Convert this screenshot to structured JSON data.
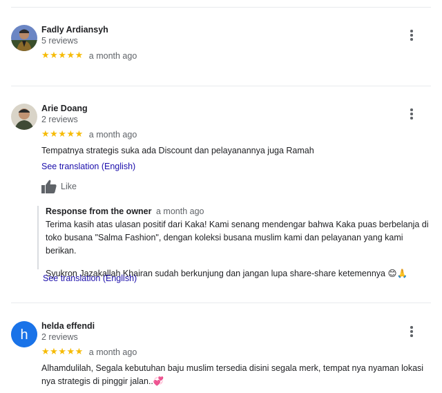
{
  "reviews": [
    {
      "name": "Fadly Ardiansyh",
      "review_count": "5 reviews",
      "stars": "★★★★★",
      "time": "a month ago",
      "avatar_icon": "person-photo-icon"
    },
    {
      "name": "Arie Doang",
      "review_count": "2 reviews",
      "stars": "★★★★★",
      "time": "a month ago",
      "avatar_icon": "person-photo-icon",
      "text": "Tempatnya strategis suka ada Discount dan pelayanannya juga Ramah",
      "translation_link": "See translation (English)",
      "like_label": "Like",
      "owner_response": {
        "title": "Response from the owner",
        "time": "a month ago",
        "paragraph1": "Terima kasih atas ulasan positif dari Kaka! Kami senang mendengar bahwa Kaka puas berbelanja di toko busana \"Salma Fashion\", dengan koleksi busana muslim kami dan pelayanan yang kami berikan.",
        "paragraph2": "Syukron Jazakallah Khairan sudah berkunjung dan jangan lupa share-share ketemennya 😊🙏",
        "translation_link": "See translation (English)"
      }
    },
    {
      "name": "helda effendi",
      "review_count": "2 reviews",
      "stars": "★★★★★",
      "time": "a month ago",
      "avatar_letter": "h",
      "avatar_color": "#1a73e8",
      "text": "Alhamdulilah, Segala kebutuhan baju muslim tersedia disini segala merk, tempat nya nyaman lokasi nya strategis di pinggir jalan..💞"
    }
  ]
}
